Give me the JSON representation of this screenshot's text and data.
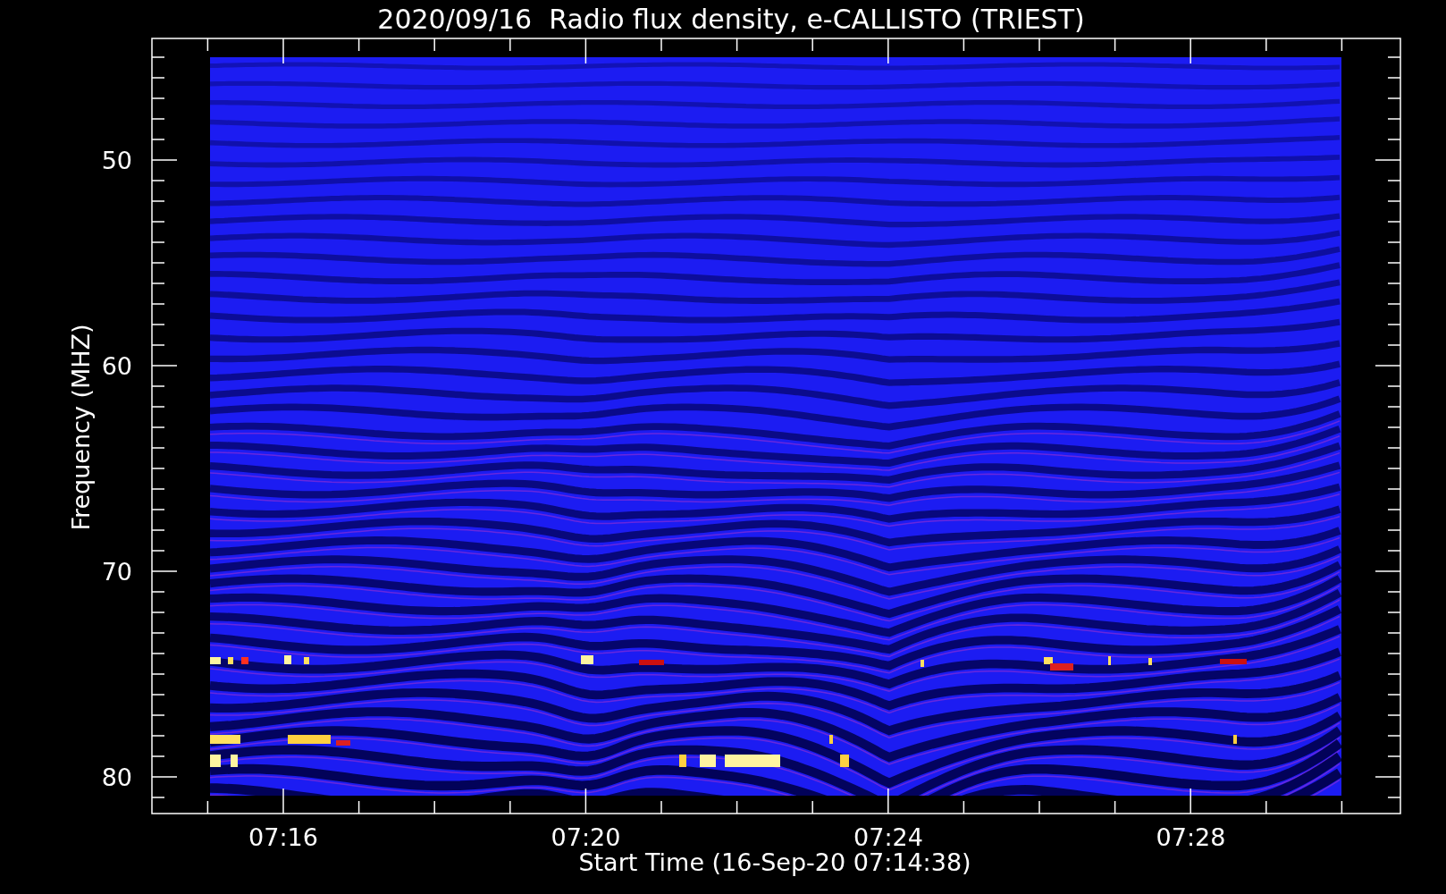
{
  "chart": {
    "title": "2020/09/16  Radio flux density, e-CALLISTO (TRIEST)",
    "xlabel": "Start Time (16-Sep-20 07:14:38)",
    "ylabel": "Frequency (MHZ)",
    "xticks": [
      "07:16",
      "07:20",
      "07:24",
      "07:28"
    ],
    "yticks": [
      "50",
      "60",
      "70",
      "80"
    ]
  }
}
